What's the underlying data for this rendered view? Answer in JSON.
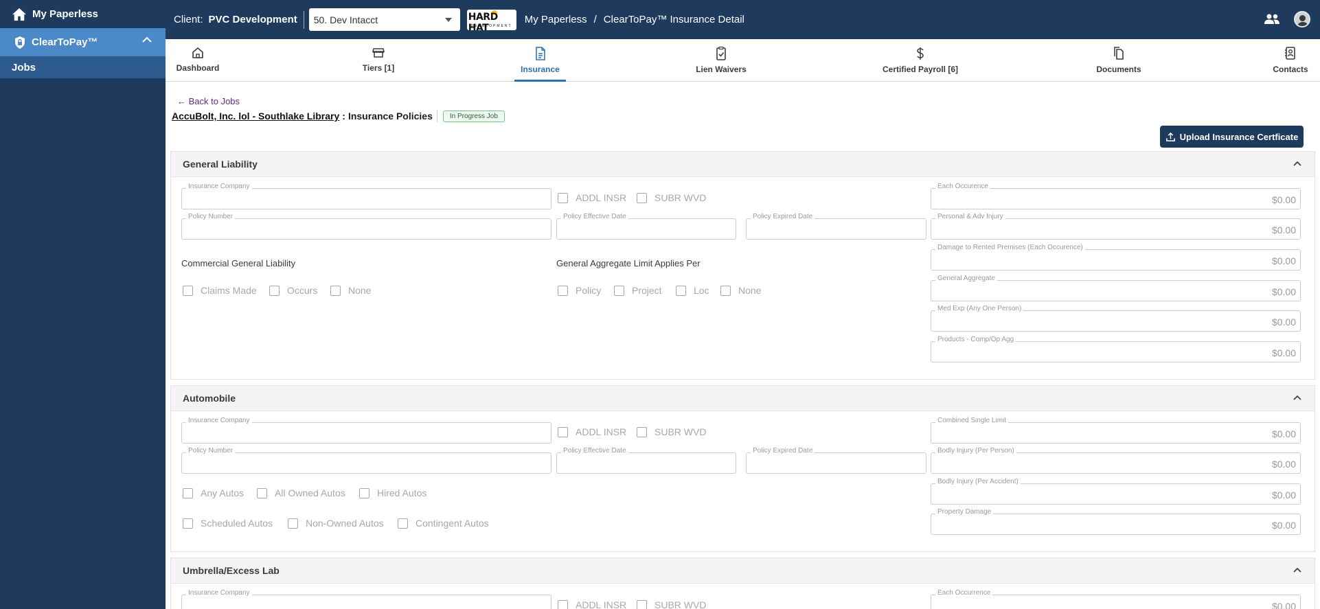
{
  "sidebar": {
    "home_label": "My Paperless",
    "app_label": "ClearToPay™",
    "items": [
      {
        "label": "Jobs"
      }
    ]
  },
  "header": {
    "client_label": "Client:",
    "client_name": "PVC Development",
    "client_select_value": "50. Dev Intacct",
    "logo_text": "HARD HAT",
    "logo_subtext": "DEVELOPMENT",
    "breadcrumb": [
      "My Paperless",
      "/",
      "ClearToPay™ Insurance Detail"
    ]
  },
  "tabs": [
    {
      "label": "Dashboard",
      "icon": "home-icon"
    },
    {
      "label": "Tiers [1]",
      "icon": "store-icon"
    },
    {
      "label": "Insurance",
      "icon": "document-icon",
      "active": true
    },
    {
      "label": "Lien Waivers",
      "icon": "clipboard-check-icon"
    },
    {
      "label": "Certified Payroll [6]",
      "icon": "dollar-icon"
    },
    {
      "label": "Documents",
      "icon": "documents-icon"
    },
    {
      "label": "Contacts",
      "icon": "contacts-icon"
    }
  ],
  "page": {
    "back_link": "← Back to Jobs",
    "job_name": "AccuBolt, Inc. lol - Southlake Library",
    "title_colon": ":",
    "title": "Insurance Policies",
    "status_badge": "In Progress Job",
    "upload_button": "Upload Insurance Certficate"
  },
  "common": {
    "insurance_company": "Insurance Company",
    "policy_number": "Policy Number",
    "policy_effective_date": "Policy Effective Date",
    "policy_expired_date": "Policy Expired Date",
    "addl_insr": "ADDL INSR",
    "subr_wvd": "SUBR WVD",
    "zero": "$0.00"
  },
  "general_liability": {
    "title": "General Liability",
    "cgl_label": "Commercial General Liability",
    "cgl_options": [
      "Claims Made",
      "Occurs",
      "None"
    ],
    "aggregate_label": "General Aggregate Limit Applies Per",
    "aggregate_options": [
      "Policy",
      "Project",
      "Loc",
      "None"
    ],
    "amounts": [
      "Each Occurence",
      "Personal & Adv Injury",
      "Damage to Rented Premises (Each Occurence)",
      "General Aggregate",
      "Med Exp (Any One Person)",
      "Products - Comp/Op Agg"
    ]
  },
  "automobile": {
    "title": "Automobile",
    "options_row1": [
      "Any Autos",
      "All Owned Autos",
      "Hired Autos"
    ],
    "options_row2": [
      "Scheduled Autos",
      "Non-Owned Autos",
      "Contingent Autos"
    ],
    "amounts": [
      "Combined Single Limit",
      "Bodly Injury (Per Person)",
      "Bodly Injury (Per Accident)",
      "Property Damage"
    ]
  },
  "umbrella": {
    "title": "Umbrella/Excess Lab",
    "amounts": [
      "Each Occurrence"
    ]
  },
  "colors": {
    "navy": "#1e3a5c",
    "accent_blue": "#2f6fb3",
    "sidebar_active": "#4b89c8"
  }
}
